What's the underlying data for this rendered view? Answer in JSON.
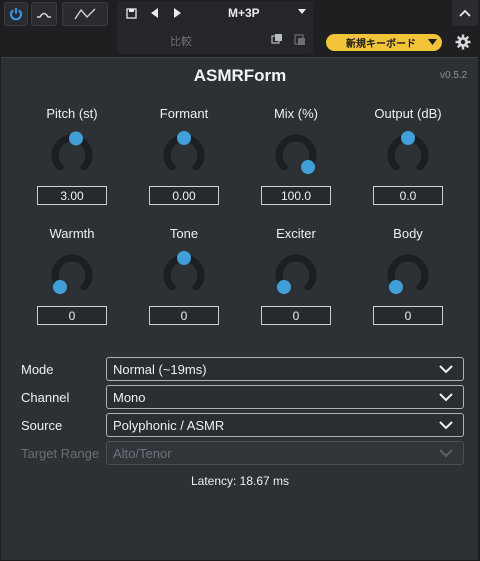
{
  "host": {
    "preset_name": "M+3P",
    "compare_label": "比較",
    "keyboard_label": "新規キーボード",
    "icons": [
      "power-icon",
      "bypass-icon",
      "automation-icon",
      "save-icon",
      "prev-icon",
      "next-icon",
      "chevron-down-icon",
      "copy-icon",
      "paste-icon",
      "chevron-up-icon",
      "gear-icon"
    ],
    "colors": {
      "power": "#3aa3ff",
      "keyboard_pill": "#f2c43a"
    }
  },
  "plugin": {
    "title": "ASMRForm",
    "version": "v0.5.2",
    "accent": "#3f9fd6",
    "knobs": [
      {
        "label": "Pitch (st)",
        "value": "3.00",
        "position": 0.55
      },
      {
        "label": "Formant",
        "value": "0.00",
        "position": 0.5
      },
      {
        "label": "Mix (%)",
        "value": "100.0",
        "position": 1.0
      },
      {
        "label": "Output (dB)",
        "value": "0.0",
        "position": 0.5
      },
      {
        "label": "Warmth",
        "value": "0",
        "position": 0.0
      },
      {
        "label": "Tone",
        "value": "0",
        "position": 0.5
      },
      {
        "label": "Exciter",
        "value": "0",
        "position": 0.0
      },
      {
        "label": "Body",
        "value": "0",
        "position": 0.0
      }
    ],
    "mode": {
      "label": "Mode",
      "value": "Normal (~19ms)"
    },
    "channel": {
      "label": "Channel",
      "value": "Mono"
    },
    "source": {
      "label": "Source",
      "value": "Polyphonic / ASMR"
    },
    "target_range": {
      "label": "Target Range",
      "value": "Alto/Tenor",
      "disabled": true
    },
    "latency": "Latency: 18.67 ms"
  }
}
